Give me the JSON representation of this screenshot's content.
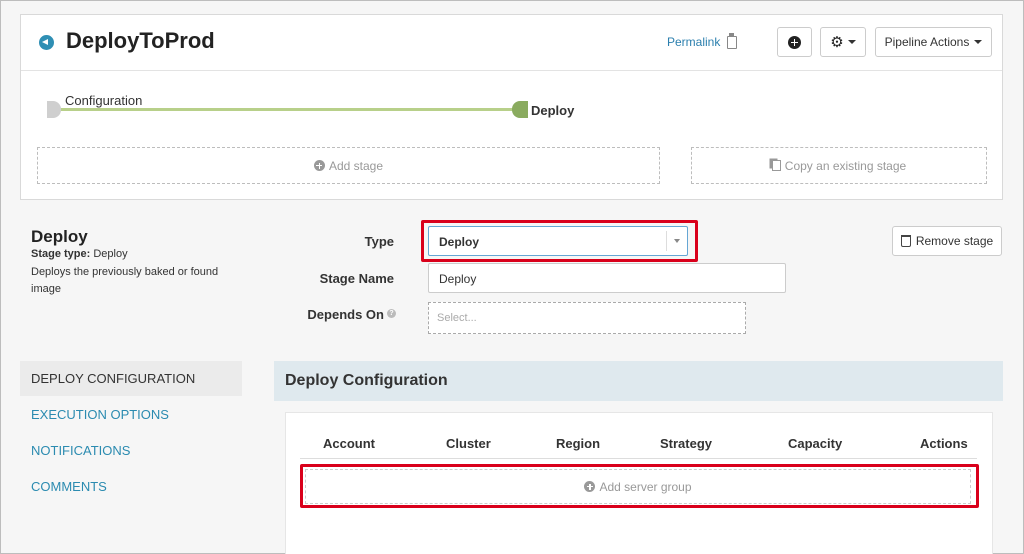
{
  "header": {
    "title": "DeployToProd",
    "permalink": "Permalink",
    "pipeline_actions": "Pipeline Actions"
  },
  "graph": {
    "nodes": [
      {
        "label": "Configuration"
      },
      {
        "label": "Deploy"
      }
    ],
    "add_stage": "Add stage",
    "copy_stage": "Copy an existing stage"
  },
  "stage": {
    "name": "Deploy",
    "type_label": "Stage type:",
    "type_value": "Deploy",
    "description": "Deploys the previously baked or found image",
    "remove_button": "Remove stage"
  },
  "form": {
    "type_label": "Type",
    "type_value": "Deploy",
    "stage_name_label": "Stage Name",
    "stage_name_value": "Deploy",
    "depends_on_label": "Depends On",
    "depends_on_placeholder": "Select..."
  },
  "nav": {
    "items": [
      {
        "label": "DEPLOY CONFIGURATION",
        "active": true
      },
      {
        "label": "EXECUTION OPTIONS",
        "active": false
      },
      {
        "label": "NOTIFICATIONS",
        "active": false
      },
      {
        "label": "COMMENTS",
        "active": false
      }
    ]
  },
  "config": {
    "title": "Deploy Configuration",
    "columns": [
      "Account",
      "Cluster",
      "Region",
      "Strategy",
      "Capacity",
      "Actions"
    ],
    "add_server_group": "Add server group"
  },
  "colors": {
    "accent": "#2b8bb0",
    "highlight": "#d9001b",
    "graph_complete": "#8aab5f",
    "graph_line": "#b8d08a"
  },
  "icons": [
    "back-arrow-icon",
    "clipboard-icon",
    "plus-circle-icon",
    "gear-icon",
    "caret-down-icon",
    "copy-icon",
    "help-icon",
    "trash-icon"
  ]
}
